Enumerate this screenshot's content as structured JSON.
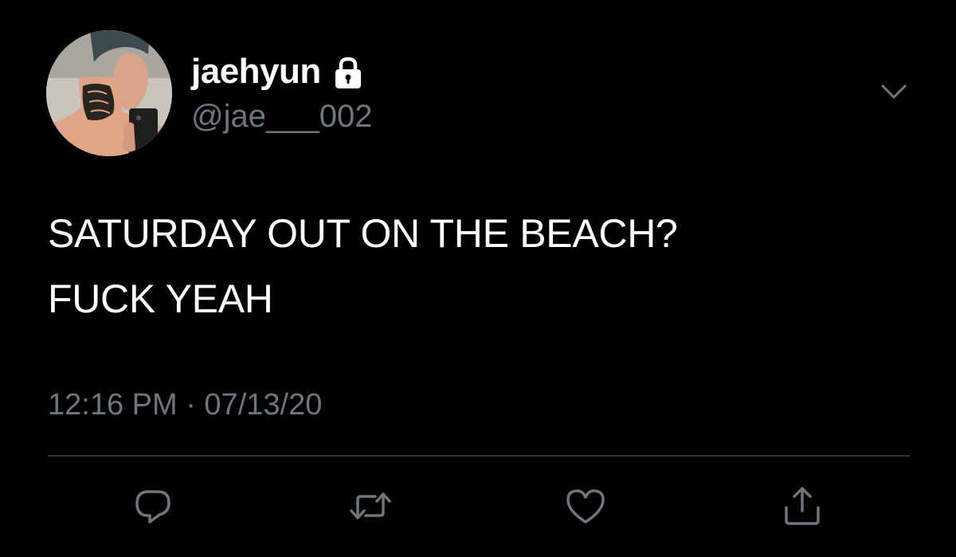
{
  "tweet": {
    "display_name": "jaehyun",
    "handle": "@jae___002",
    "protected_icon": "lock-icon",
    "text_lines": [
      "SATURDAY OUT ON THE BEACH?",
      "FUCK YEAH"
    ],
    "timestamp": "12:16 PM · 07/13/20"
  },
  "menu": {
    "icon": "chevron-down-icon"
  },
  "actions": [
    {
      "icon": "reply-icon"
    },
    {
      "icon": "retweet-icon"
    },
    {
      "icon": "heart-icon"
    },
    {
      "icon": "share-icon"
    }
  ],
  "colors": {
    "background": "#000000",
    "text_primary": "#ffffff",
    "text_secondary": "#6e767d",
    "divider": "#2f3336",
    "icon": "#6e767d"
  }
}
